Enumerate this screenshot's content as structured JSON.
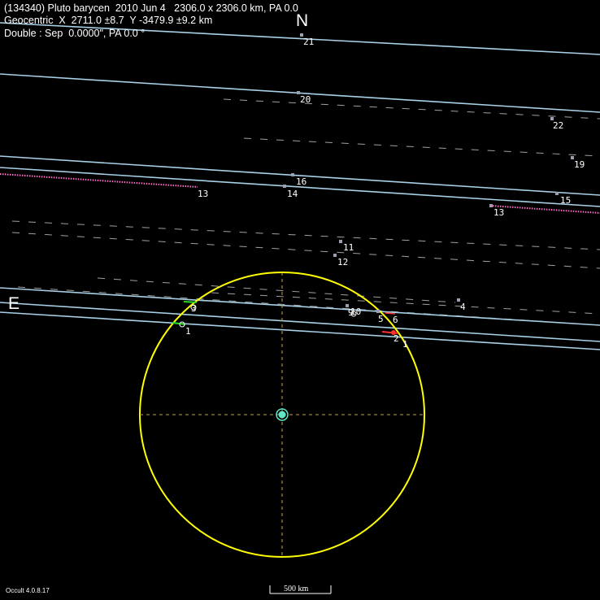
{
  "header": {
    "line1": "(134340) Pluto barycen  2010 Jun 4   2306.0 x 2306.0 km, PA 0.0",
    "line2": "Geocentric  X  2711.0 ±8.7  Y -3479.9 ±9.2 km",
    "line3": "Double : Sep  0.0000\", PA 0.0 °"
  },
  "compass": {
    "north": "N",
    "east": "E"
  },
  "footer": {
    "version": "Occult 4.0.8.17",
    "scale_label": "500 km"
  },
  "colors": {
    "background": "#000000",
    "body_outline": "#ffff00",
    "body_center": "#5fe6c8",
    "chord_line": "#a8d0e6",
    "miss_line": "#c8c8c8",
    "no_data_line": "#ff6ec7",
    "observer_marker": "#9aa0b0",
    "positive_event": "#22dd22",
    "negative_event": "#ff3030"
  },
  "chords": [
    {
      "id": "21",
      "label": "21",
      "type": "miss"
    },
    {
      "id": "20",
      "label": "20",
      "type": "miss"
    },
    {
      "id": "22",
      "label": "22",
      "type": "miss"
    },
    {
      "id": "19",
      "label": "19",
      "type": "miss"
    },
    {
      "id": "16",
      "label": "16",
      "type": "miss"
    },
    {
      "id": "14",
      "label": "14",
      "type": "miss"
    },
    {
      "id": "15",
      "label": "15",
      "type": "miss"
    },
    {
      "id": "13a",
      "label": "13",
      "type": "no-data"
    },
    {
      "id": "13b",
      "label": "13",
      "type": "no-data"
    },
    {
      "id": "11",
      "label": "11",
      "type": "miss"
    },
    {
      "id": "12",
      "label": "12",
      "type": "miss"
    },
    {
      "id": "9",
      "label": "9",
      "type": "miss"
    },
    {
      "id": "10",
      "label": "10",
      "type": "miss"
    },
    {
      "id": "4",
      "label": "4",
      "type": "miss"
    },
    {
      "id": "5",
      "label": "5",
      "type": "miss"
    },
    {
      "id": "6",
      "label": "6",
      "type": "miss"
    },
    {
      "id": "3",
      "label": "3",
      "type": "positive"
    },
    {
      "id": "1w",
      "label": "1",
      "type": "positive"
    },
    {
      "id": "2e",
      "label": "2",
      "type": "positive"
    },
    {
      "id": "1e",
      "label": "1",
      "type": "positive"
    }
  ]
}
